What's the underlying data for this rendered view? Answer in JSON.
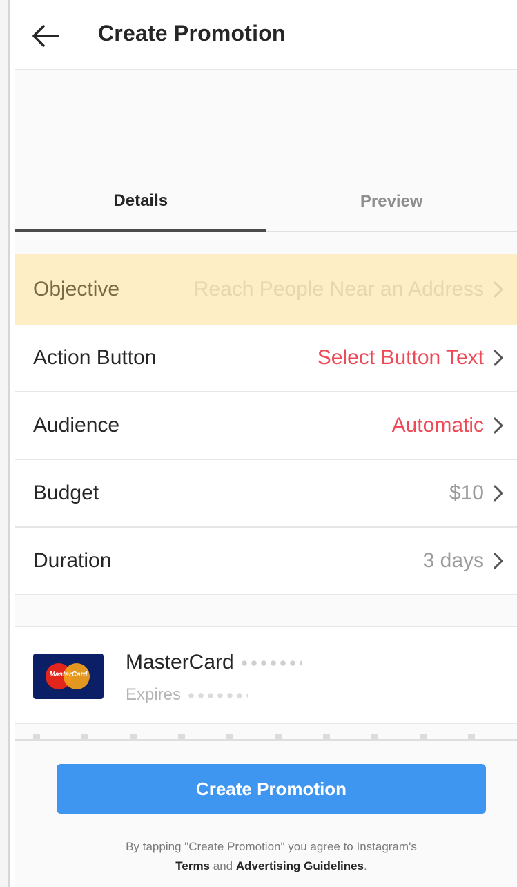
{
  "header": {
    "title": "Create Promotion",
    "back_icon": "arrow-left-icon"
  },
  "tabs": [
    {
      "label": "Details",
      "active": true
    },
    {
      "label": "Preview",
      "active": false
    }
  ],
  "settings": [
    {
      "label": "Objective",
      "value": "Reach People Near an Address",
      "value_color": "muted",
      "highlighted": true
    },
    {
      "label": "Action Button",
      "value": "Select Button Text",
      "value_color": "#ed4956"
    },
    {
      "label": "Audience",
      "value": "Automatic",
      "value_color": "#ed4956"
    },
    {
      "label": "Budget",
      "value": "$10",
      "value_color": "#9b9b9b"
    },
    {
      "label": "Duration",
      "value": "3 days",
      "value_color": "#9b9b9b"
    }
  ],
  "payment": {
    "brand_text": "MasterCard",
    "card_name": "MasterCard",
    "expires_label": "Expires"
  },
  "cta": {
    "label": "Create Promotion",
    "color": "#3f96f0"
  },
  "legal": {
    "prefix": "By tapping \"Create Promotion\" you agree to Instagram's",
    "terms": "Terms",
    "and": "and",
    "guidelines": "Advertising Guidelines",
    "suffix": "."
  },
  "colors": {
    "highlight_bg": "#fdeec5",
    "accent_red": "#ed4956"
  }
}
